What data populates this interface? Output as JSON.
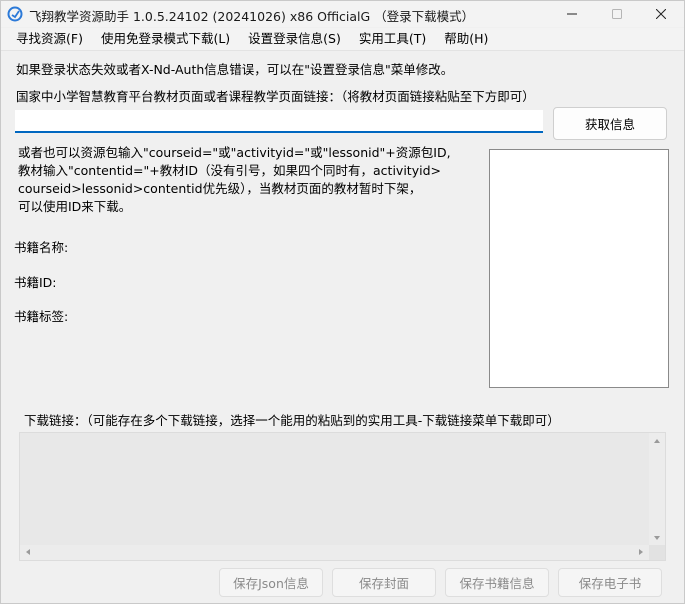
{
  "window": {
    "title": "飞翔教学资源助手 1.0.5.24102 (20241026) x86 OfficialG （登录下载模式）"
  },
  "menu": {
    "items": [
      "寻找资源(F)",
      "使用免登录模式下载(L)",
      "设置登录信息(S)",
      "实用工具(T)",
      "帮助(H)"
    ]
  },
  "main": {
    "warning": "如果登录状态失效或者X-Nd-Auth信息错误，可以在\"设置登录信息\"菜单修改。",
    "url_prompt": "国家中小学智慧教育平台教材页面或者课程教学页面链接：（将教材页面链接粘贴至下方即可）",
    "url_value": "",
    "fetch_button": "获取信息",
    "info_lines": [
      "或者也可以资源包输入\"courseid=\"或\"activityid=\"或\"lessonid\"+资源包ID,",
      "教材输入\"contentid=\"+教材ID（没有引号，如果四个同时有，activityid>",
      "courseid>lessonid>contentid优先级），当教材页面的教材暂时下架，",
      "可以使用ID来下载。"
    ],
    "book_name_label": "书籍名称:",
    "book_id_label": "书籍ID:",
    "book_tags_label": "书籍标签:",
    "download_links_label": "下载链接：（可能存在多个下载链接，选择一个能用的粘贴到的实用工具-下载链接菜单下载即可）",
    "download_links_value": ""
  },
  "buttons": {
    "save_json": "保存Json信息",
    "save_cover": "保存封面",
    "save_book_info": "保存书籍信息",
    "save_ebook": "保存电子书"
  },
  "colors": {
    "accent": "#0067c0",
    "window_bg": "#f0f0f0",
    "disabled_text": "#8a8a8a"
  },
  "icons": {
    "app": "app-logo-icon",
    "minimize": "minimize-icon",
    "maximize": "maximize-icon",
    "close": "close-icon"
  }
}
